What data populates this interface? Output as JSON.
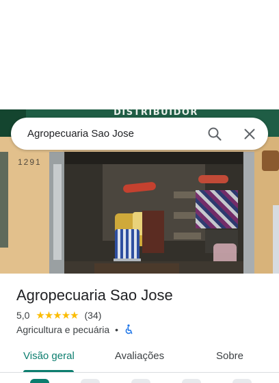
{
  "search": {
    "query": "Agropecuaria Sao Jose"
  },
  "photo": {
    "sign_text": "DISTRIBUIDOR",
    "house_number": "1291"
  },
  "place": {
    "name": "Agropecuaria Sao Jose",
    "rating_value": "5,0",
    "stars": "★★★★★",
    "review_count": "(34)",
    "category": "Agricultura e pecuária",
    "separator": "•"
  },
  "tabs": [
    {
      "label": "Visão geral",
      "active": true
    },
    {
      "label": "Avaliações",
      "active": false
    },
    {
      "label": "Sobre",
      "active": false
    }
  ],
  "colors": {
    "accent": "#0b7d6e",
    "star": "#fbbc04",
    "accessibility_icon": "#1a73e8"
  },
  "icons": [
    "search-icon",
    "close-icon",
    "wheelchair-icon"
  ]
}
